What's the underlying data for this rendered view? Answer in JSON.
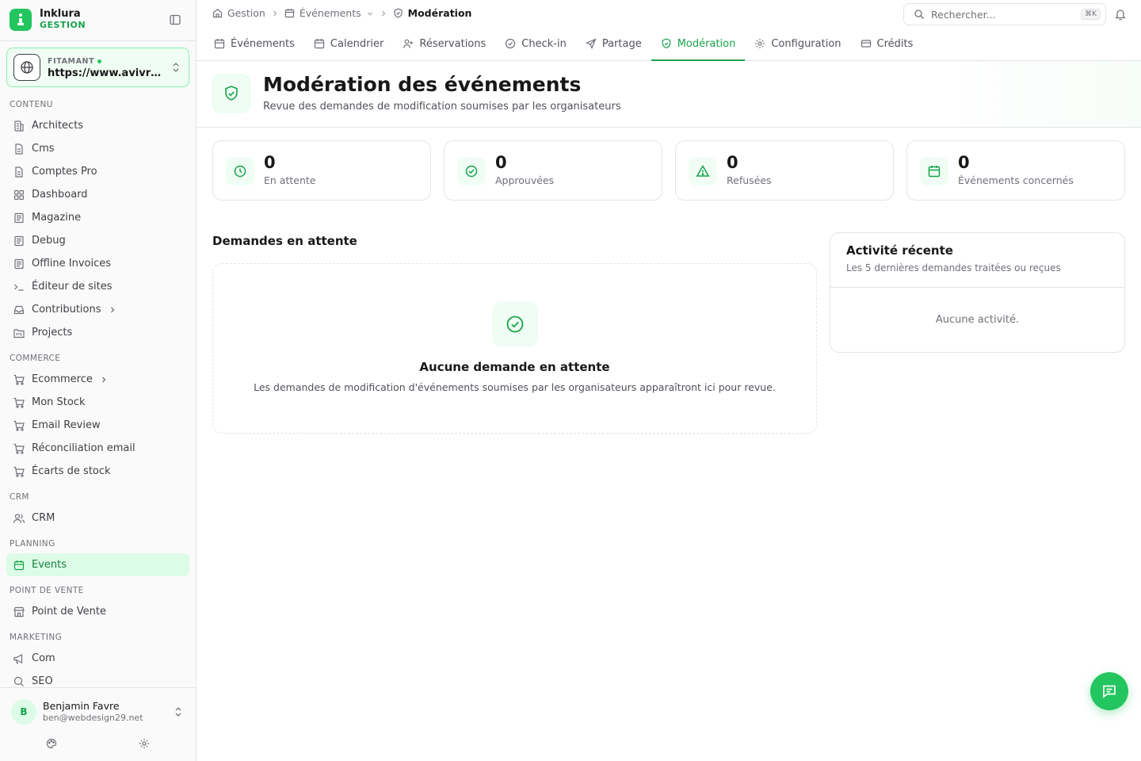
{
  "app": {
    "name": "Inklura",
    "subtitle": "GESTION"
  },
  "workspace": {
    "label": "FITAMANT",
    "url": "https://www.avivre-paris.fr"
  },
  "sidebar": {
    "sections": {
      "contenu": "CONTENU",
      "commerce": "COMMERCE",
      "crm": "CRM",
      "planning": "PLANNING",
      "pdv": "POINT DE VENTE",
      "marketing": "MARKETING"
    },
    "items": {
      "architects": "Architects",
      "cms": "Cms",
      "comptes_pro": "Comptes Pro",
      "dashboard": "Dashboard",
      "magazine": "Magazine",
      "debug": "Debug",
      "offline_invoices": "Offline Invoices",
      "editeur_sites": "Éditeur de sites",
      "contributions": "Contributions",
      "projects": "Projects",
      "ecommerce": "Ecommerce",
      "mon_stock": "Mon Stock",
      "email_review": "Email Review",
      "reconciliation": "Réconciliation email",
      "ecarts_stock": "Écarts de stock",
      "crm": "CRM",
      "events": "Events",
      "point_de_vente": "Point de Vente",
      "com": "Com",
      "seo": "SEO"
    }
  },
  "user": {
    "name": "Benjamin Favre",
    "email": "ben@webdesign29.net",
    "initial": "B"
  },
  "breadcrumb": {
    "home": "Gestion",
    "parent": "Événements",
    "current": "Modération"
  },
  "search": {
    "placeholder": "Rechercher...",
    "shortcut": "⌘K"
  },
  "tabs": {
    "evenements": "Événements",
    "calendrier": "Calendrier",
    "reservations": "Réservations",
    "checkin": "Check-in",
    "partage": "Partage",
    "moderation": "Modération",
    "configuration": "Configuration",
    "credits": "Crédits"
  },
  "header": {
    "title": "Modération des événements",
    "subtitle": "Revue des demandes de modification soumises par les organisateurs"
  },
  "stats": {
    "pending": {
      "value": "0",
      "label": "En attente"
    },
    "approved": {
      "value": "0",
      "label": "Approuvées"
    },
    "refused": {
      "value": "0",
      "label": "Refusées"
    },
    "events": {
      "value": "0",
      "label": "Événements concernés"
    }
  },
  "pending": {
    "title": "Demandes en attente",
    "empty_title": "Aucune demande en attente",
    "empty_text": "Les demandes de modification d'événements soumises par les organisateurs apparaîtront ici pour revue."
  },
  "activity": {
    "title": "Activité récente",
    "subtitle": "Les 5 dernières demandes traitées ou reçues",
    "empty": "Aucune activité."
  },
  "colors": {
    "accent": "#16a34a",
    "accent_light": "#f0fdf4",
    "brand": "#22c55e"
  }
}
